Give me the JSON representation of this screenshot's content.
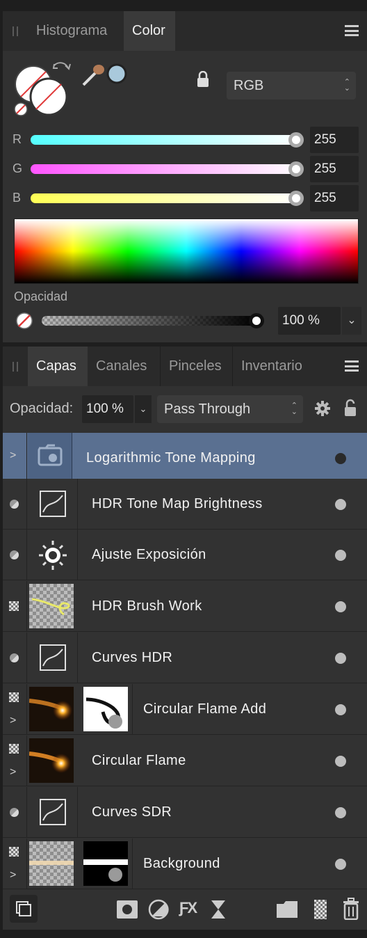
{
  "color_panel": {
    "tabs": [
      {
        "label": "Histograma",
        "active": false
      },
      {
        "label": "Color",
        "active": true
      }
    ],
    "model": "RGB",
    "channels": [
      {
        "name": "R",
        "value": "255",
        "color": "#55ffff"
      },
      {
        "name": "G",
        "value": "255",
        "color": "#ff55ff"
      },
      {
        "name": "B",
        "value": "255",
        "color": "#ffff55"
      }
    ],
    "opacity_label": "Opacidad",
    "opacity_value": "100 %"
  },
  "layers_panel": {
    "tabs": [
      {
        "label": "Capas",
        "active": true
      },
      {
        "label": "Canales",
        "active": false
      },
      {
        "label": "Pinceles",
        "active": false
      },
      {
        "label": "Inventario",
        "active": false
      }
    ],
    "opacity_label": "Opacidad:",
    "opacity_value": "100 %",
    "blend_mode": "Pass Through",
    "layers": [
      {
        "name": "Logarithmic Tone Mapping",
        "thumb": "group-folder-icon",
        "selected": true,
        "expandable": true
      },
      {
        "name": "HDR Tone Map Brightness",
        "thumb": "curves-icon"
      },
      {
        "name": "Ajuste Exposición",
        "thumb": "exposure-sun-icon"
      },
      {
        "name": "HDR Brush Work",
        "thumb": "brush-stroke-thumbnail"
      },
      {
        "name": "Curves HDR",
        "thumb": "curves-icon"
      },
      {
        "name": "Circular Flame Add",
        "thumb": "flame-thumbnail",
        "mask": true,
        "expandable": true
      },
      {
        "name": "Circular Flame",
        "thumb": "flame-thumbnail",
        "expandable": true
      },
      {
        "name": "Curves SDR",
        "thumb": "curves-icon"
      },
      {
        "name": "Background",
        "thumb": "background-thumbnail",
        "mask": true,
        "expandable": true
      }
    ]
  },
  "accent_color": "#5a7091"
}
